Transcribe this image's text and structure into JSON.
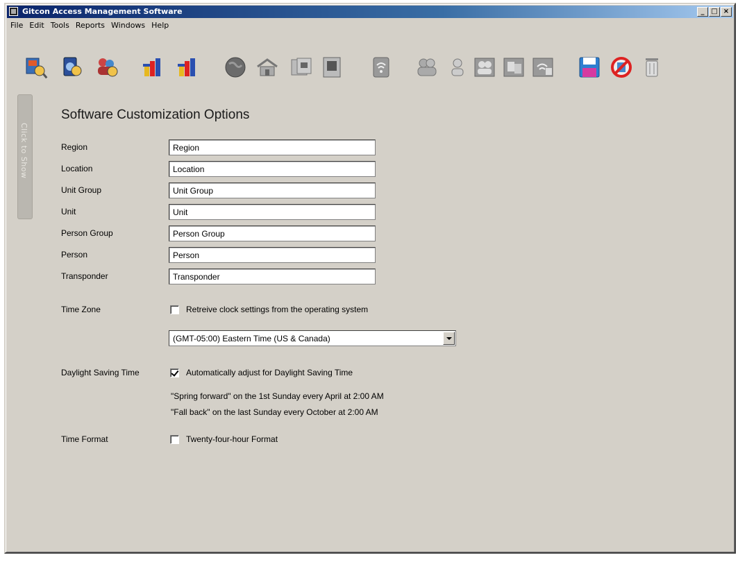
{
  "window": {
    "title": "Gitcon Access Management Software"
  },
  "window_buttons": {
    "minimize": "_",
    "maximize": "□",
    "close": "×"
  },
  "menu": [
    {
      "label": "File"
    },
    {
      "label": "Edit"
    },
    {
      "label": "Tools"
    },
    {
      "label": "Reports"
    },
    {
      "label": "Windows"
    },
    {
      "label": "Help"
    }
  ],
  "toolbar_icons": [
    "region-search-icon",
    "unit-search-icon",
    "person-search-icon",
    "report-chart-icon",
    "report-chart-icon",
    "globe-icon",
    "location-building-icon",
    "unit-group-icon",
    "unit-icon",
    "transponder-icon",
    "person-group-icon",
    "person-icon",
    "person-group-multi-icon",
    "unit-group-multi-icon",
    "transponder-group-icon",
    "save-icon",
    "cancel-icon",
    "delete-icon"
  ],
  "side_tab": {
    "label": "Click to Show"
  },
  "heading": "Software Customization Options",
  "fields": [
    {
      "label": "Region",
      "value": "Region"
    },
    {
      "label": "Location",
      "value": "Location"
    },
    {
      "label": "Unit Group",
      "value": "Unit Group"
    },
    {
      "label": "Unit",
      "value": "Unit"
    },
    {
      "label": "Person Group",
      "value": "Person Group"
    },
    {
      "label": "Person",
      "value": "Person"
    },
    {
      "label": "Transponder",
      "value": "Transponder"
    }
  ],
  "time_zone": {
    "label": "Time Zone",
    "checkbox_label": "Retreive clock settings from the operating system",
    "checked": false,
    "selected": "(GMT-05:00) Eastern Time (US & Canada)"
  },
  "dst": {
    "label": "Daylight Saving Time",
    "checkbox_label": "Automatically adjust for Daylight Saving Time",
    "checked": true,
    "spring": "\"Spring forward\" on the 1st Sunday every April at 2:00 AM",
    "fall": "\"Fall back\" on the last Sunday every October at 2:00 AM"
  },
  "time_format": {
    "label": "Time Format",
    "checkbox_label": "Twenty-four-hour Format",
    "checked": false
  }
}
